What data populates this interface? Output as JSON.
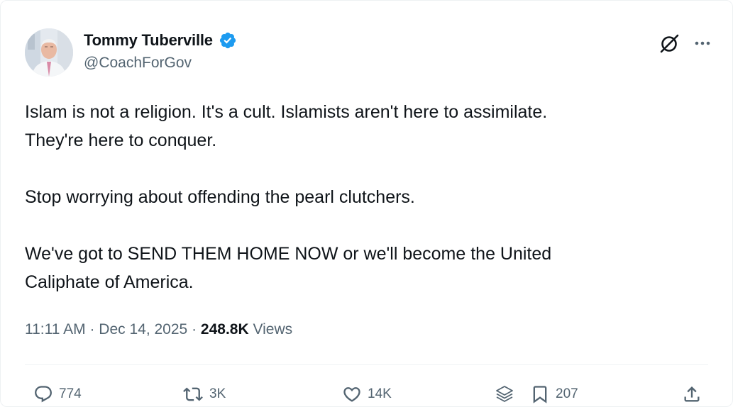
{
  "author": {
    "display_name": "Tommy Tuberville",
    "handle": "@CoachForGov",
    "avatar_icon": "profile-photo",
    "verified_icon": "verified-badge-icon",
    "verified_color": "#1d9bf0"
  },
  "header_actions": {
    "grok_icon": "grok-icon",
    "more_icon": "more-icon"
  },
  "tweet": {
    "paragraphs": [
      "Islam is not a religion. It's a cult. Islamists aren't here to assimilate.",
      "They're here to conquer.",
      "Stop worrying about offending the pearl clutchers.",
      "We've got to SEND THEM HOME NOW or we'll become the United",
      "Caliphate of America."
    ]
  },
  "meta": {
    "time": "11:11 AM",
    "separator": " · ",
    "date": "Dec 14, 2025",
    "views_count": "248.8K",
    "views_label": "Views"
  },
  "actions": {
    "replies": "774",
    "reposts": "3K",
    "likes": "14K",
    "bookmarks": "207"
  },
  "colors": {
    "text_primary": "#0f1419",
    "text_secondary": "#536471",
    "accent_blue": "#1d9bf0",
    "divider": "#eff3f4"
  }
}
